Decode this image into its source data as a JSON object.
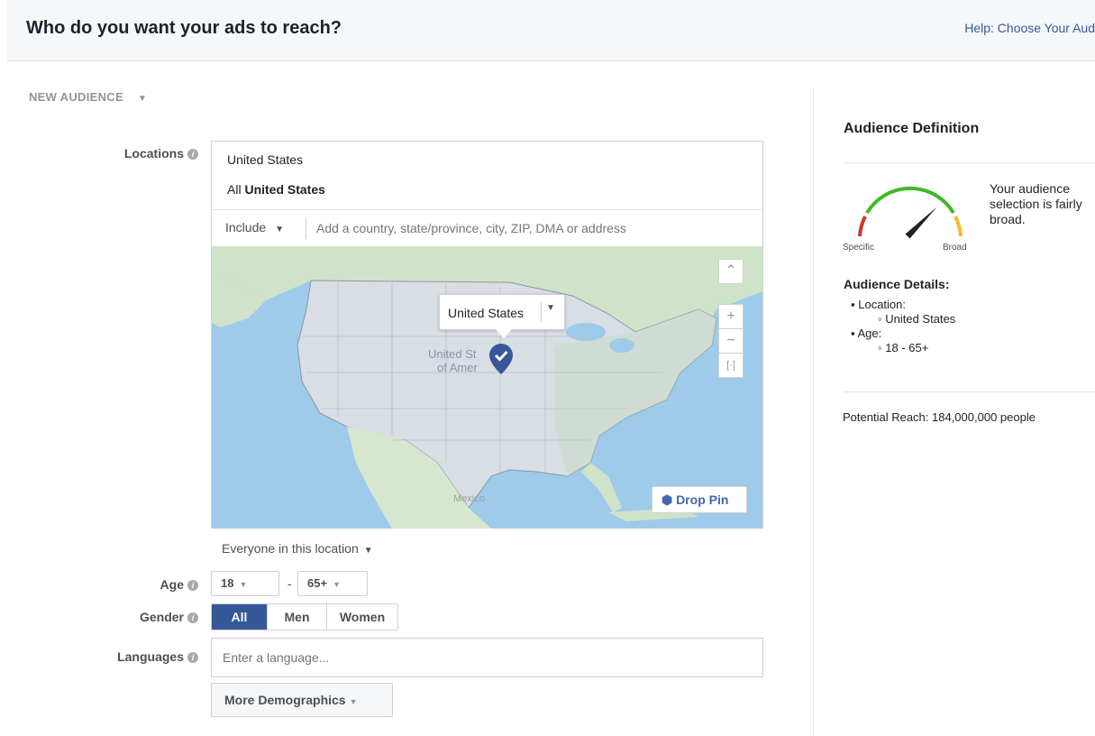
{
  "header": {
    "title": "Who do you want your ads to reach?",
    "help_link": "Help: Choose Your Aud"
  },
  "audience_menu": {
    "label": "NEW AUDIENCE"
  },
  "locations": {
    "label": "Locations",
    "country": "United States",
    "all_prefix": "All",
    "all_country": "United States",
    "include_label": "Include",
    "input_placeholder": "Add a country, state/province, city, ZIP, DMA or address",
    "map": {
      "popup_label": "United States",
      "land_label_line1": "United St",
      "land_label_line2": "of Amer",
      "mexico_label": "Mexico",
      "drop_pin_label": "Drop Pin",
      "zoom_in": "+",
      "zoom_out": "−"
    },
    "everyone_label": "Everyone in this location"
  },
  "age": {
    "label": "Age",
    "min": "18",
    "separator": "-",
    "max": "65+"
  },
  "gender": {
    "label": "Gender",
    "options": [
      "All",
      "Men",
      "Women"
    ],
    "selected": "All"
  },
  "languages": {
    "label": "Languages",
    "placeholder": "Enter a language..."
  },
  "more_demographics": {
    "label": "More Demographics"
  },
  "sidebar": {
    "title": "Audience Definition",
    "gauge_specific": "Specific",
    "gauge_broad": "Broad",
    "gauge_level": 0.75,
    "breadth_text_line1": "Your audience",
    "breadth_text_line2": "selection is fairly",
    "breadth_text_line3": "broad.",
    "details_title": "Audience Details:",
    "location_label": "Location:",
    "location_value": "United States",
    "age_label": "Age:",
    "age_value": "18 - 65+",
    "potential_reach": "Potential Reach: 184,000,000 people"
  },
  "colors": {
    "accent": "#365899",
    "link": "#4267b2",
    "gauge_red": "#d0342c",
    "gauge_green": "#42b72a",
    "gauge_orange": "#f7b928",
    "pin": "#365899"
  }
}
